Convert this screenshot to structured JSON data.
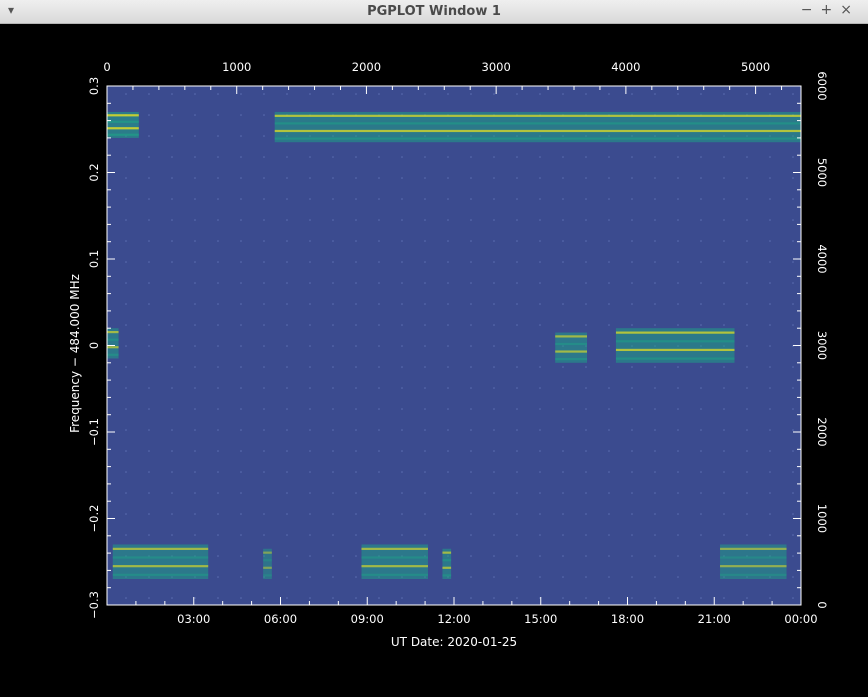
{
  "window": {
    "title": "PGPLOT Window 1",
    "menu_icon": "triangle-down",
    "controls": [
      "−",
      "+",
      "×"
    ]
  },
  "chart_data": {
    "type": "heatmap",
    "xlabel": "UT Date: 2020-01-25",
    "ylabel": "Frequency − 484.000 MHz",
    "x_bottom_ticks": [
      "03:00",
      "06:00",
      "09:00",
      "12:00",
      "15:00",
      "18:00",
      "21:00",
      "00:00"
    ],
    "x_bottom_range_hours": [
      0,
      24
    ],
    "x_top_ticks": [
      "0",
      "1000",
      "2000",
      "3000",
      "4000",
      "5000"
    ],
    "x_top_range": [
      0,
      5350
    ],
    "y_left_ticks": [
      "0.3",
      "0.2",
      "0.1",
      "0",
      "−0.1",
      "−0.2",
      "−0.3"
    ],
    "y_left_range": [
      -0.3,
      0.3
    ],
    "y_right_ticks": [
      "6000",
      "5000",
      "4000",
      "3000",
      "2000",
      "1000",
      "0"
    ],
    "y_right_range": [
      0,
      6000
    ],
    "colors": {
      "background": "#3b4b8f",
      "low": "#3b4b8f",
      "mid": "#1fa187",
      "high": "#f2e61b"
    },
    "signal_regions": [
      {
        "t_start": 0.0,
        "t_end": 1.1,
        "f_low": 0.24,
        "f_high": 0.27,
        "level": 0.9
      },
      {
        "t_start": 5.8,
        "t_end": 24.0,
        "f_low": 0.235,
        "f_high": 0.27,
        "level": 0.8
      },
      {
        "t_start": 0.0,
        "t_end": 0.4,
        "f_low": -0.015,
        "f_high": 0.02,
        "level": 0.7
      },
      {
        "t_start": 15.5,
        "t_end": 16.6,
        "f_low": -0.02,
        "f_high": 0.015,
        "level": 0.7
      },
      {
        "t_start": 17.6,
        "t_end": 21.7,
        "f_low": -0.02,
        "f_high": 0.02,
        "level": 0.8
      },
      {
        "t_start": 0.2,
        "t_end": 3.5,
        "f_low": -0.27,
        "f_high": -0.23,
        "level": 0.7
      },
      {
        "t_start": 5.4,
        "t_end": 5.7,
        "f_low": -0.27,
        "f_high": -0.235,
        "level": 0.5
      },
      {
        "t_start": 8.8,
        "t_end": 11.1,
        "f_low": -0.27,
        "f_high": -0.23,
        "level": 0.7
      },
      {
        "t_start": 11.6,
        "t_end": 11.9,
        "f_low": -0.27,
        "f_high": -0.235,
        "level": 0.7
      },
      {
        "t_start": 21.2,
        "t_end": 23.5,
        "f_low": -0.27,
        "f_high": -0.23,
        "level": 0.6
      }
    ]
  }
}
